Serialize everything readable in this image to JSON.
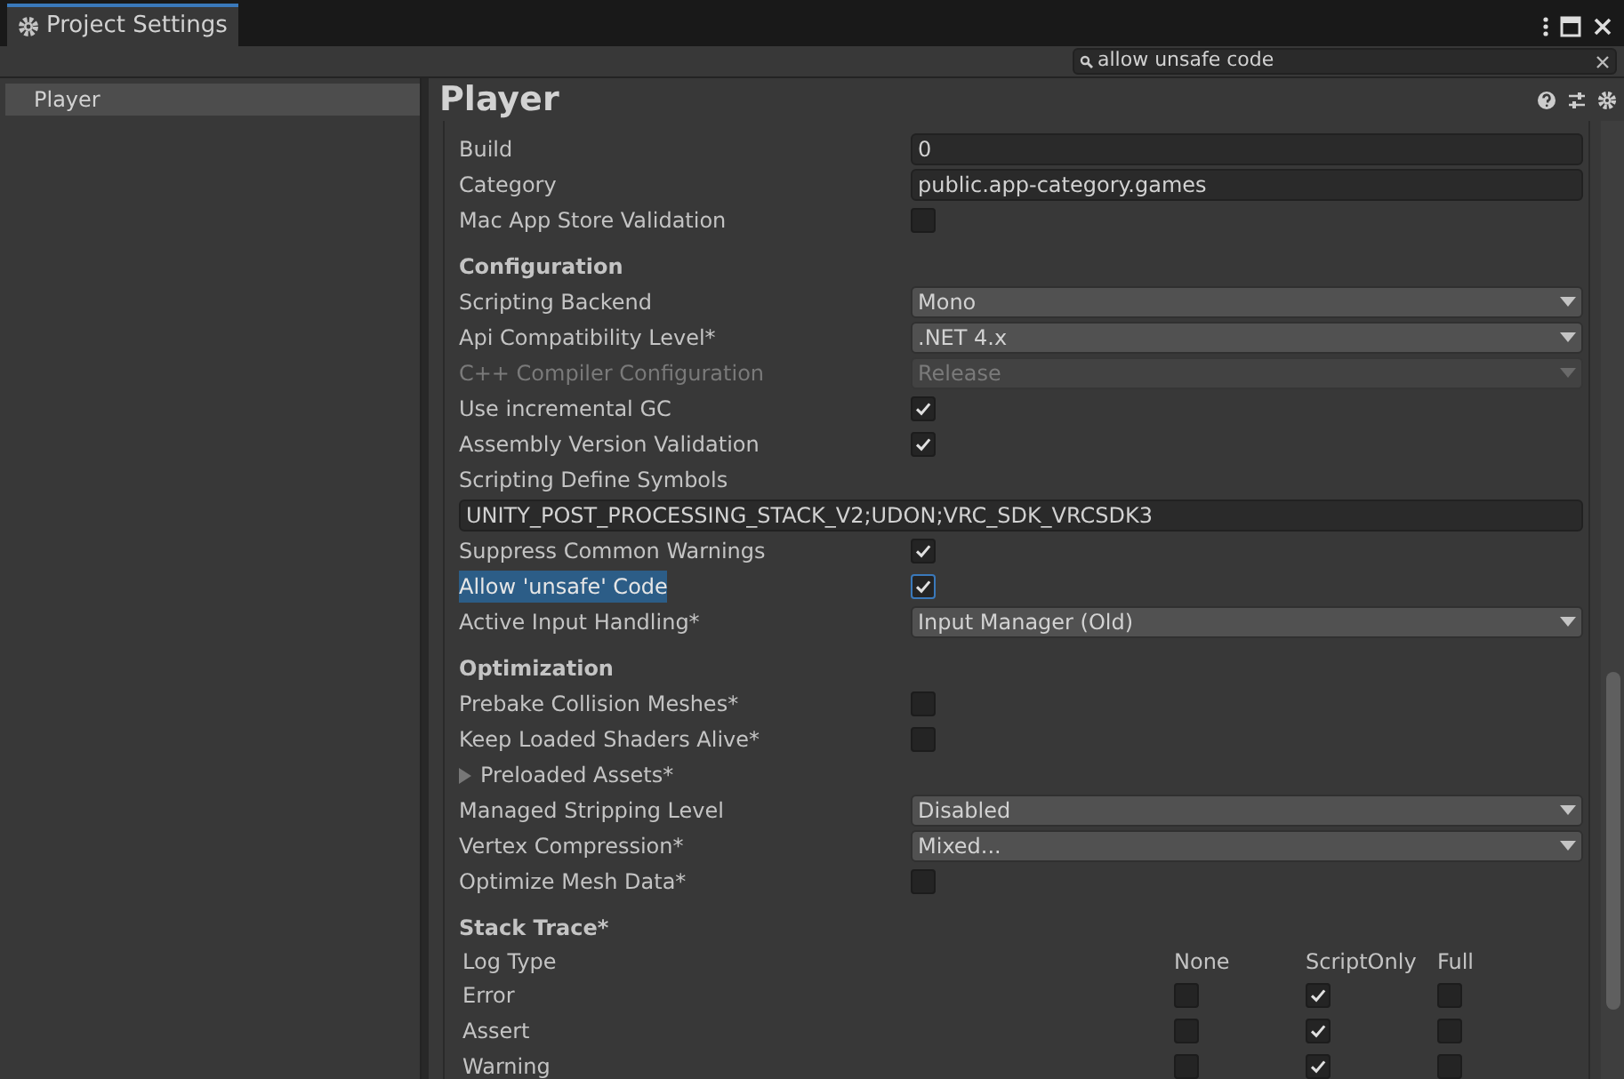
{
  "window": {
    "tab": "Project Settings"
  },
  "search": {
    "value": "allow unsafe code"
  },
  "sidebar": {
    "items": [
      {
        "label": "Player",
        "selected": true
      }
    ]
  },
  "panel": {
    "title": "Player"
  },
  "rows": [
    {
      "kind": "field",
      "label": "Build",
      "value": "0"
    },
    {
      "kind": "field",
      "label": "Category",
      "value": "public.app-category.games"
    },
    {
      "kind": "checkbox",
      "label": "Mac App Store Validation",
      "checked": false
    },
    {
      "kind": "heading",
      "label": "Configuration"
    },
    {
      "kind": "dropdown",
      "label": "Scripting Backend",
      "value": "Mono"
    },
    {
      "kind": "dropdown",
      "label": "Api Compatibility Level*",
      "value": ".NET 4.x"
    },
    {
      "kind": "dropdown",
      "label": "C++ Compiler Configuration",
      "value": "Release",
      "disabled": true
    },
    {
      "kind": "checkbox",
      "label": "Use incremental GC",
      "checked": true
    },
    {
      "kind": "checkbox",
      "label": "Assembly Version Validation",
      "checked": true
    },
    {
      "kind": "label",
      "label": "Scripting Define Symbols"
    },
    {
      "kind": "wide-field",
      "value": "UNITY_POST_PROCESSING_STACK_V2;UDON;VRC_SDK_VRCSDK3"
    },
    {
      "kind": "checkbox",
      "label": "Suppress Common Warnings",
      "checked": true
    },
    {
      "kind": "checkbox",
      "label": "Allow 'unsafe' Code",
      "checked": true,
      "highlighted": true
    },
    {
      "kind": "dropdown",
      "label": "Active Input Handling*",
      "value": "Input Manager (Old)"
    },
    {
      "kind": "heading",
      "label": "Optimization"
    },
    {
      "kind": "checkbox",
      "label": "Prebake Collision Meshes*",
      "checked": false
    },
    {
      "kind": "checkbox",
      "label": "Keep Loaded Shaders Alive*",
      "checked": false
    },
    {
      "kind": "foldout",
      "label": "Preloaded Assets*",
      "expanded": false
    },
    {
      "kind": "dropdown",
      "label": "Managed Stripping Level",
      "value": "Disabled"
    },
    {
      "kind": "dropdown",
      "label": "Vertex Compression*",
      "value": "Mixed..."
    },
    {
      "kind": "checkbox",
      "label": "Optimize Mesh Data*",
      "checked": false
    },
    {
      "kind": "heading",
      "label": "Stack Trace*"
    }
  ],
  "stack_trace": {
    "columns": [
      "Log Type",
      "None",
      "ScriptOnly",
      "Full"
    ],
    "rows": [
      {
        "label": "Error",
        "none": false,
        "script_only": true,
        "full": false
      },
      {
        "label": "Assert",
        "none": false,
        "script_only": true,
        "full": false
      },
      {
        "label": "Warning",
        "none": false,
        "script_only": true,
        "full": false
      }
    ]
  }
}
